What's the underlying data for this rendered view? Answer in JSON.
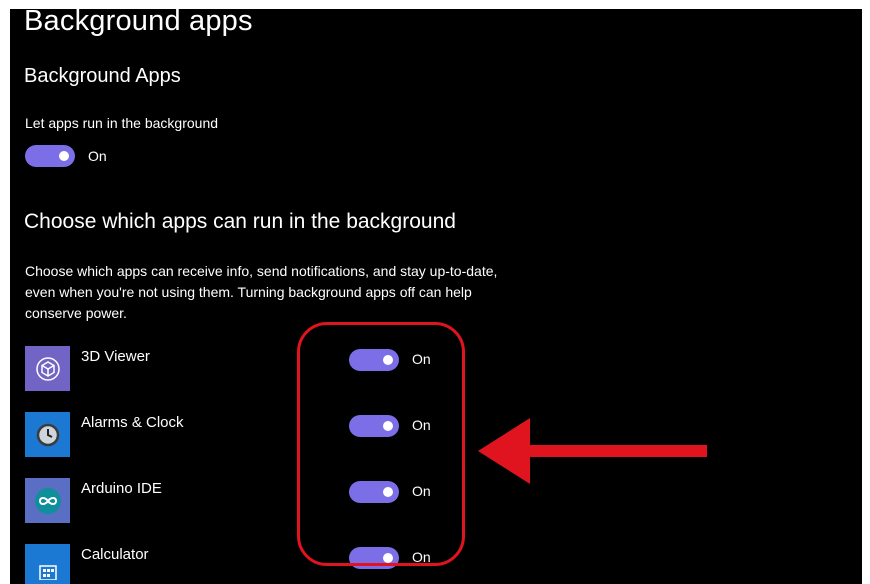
{
  "page": {
    "title": "Background apps"
  },
  "background_apps": {
    "section_title": "Background Apps",
    "setting_label": "Let apps run in the background",
    "toggle_state": "On",
    "toggle_on": true
  },
  "choose_apps": {
    "section_title": "Choose which apps can run in the background",
    "description": "Choose which apps can receive info, send notifications, and stay up-to-date, even when you're not using them. Turning background apps off can help conserve power.",
    "apps": [
      {
        "name": "3D Viewer",
        "icon": "cube-icon",
        "tile_color": "#7264c4",
        "toggle_state": "On",
        "toggle_on": true
      },
      {
        "name": "Alarms & Clock",
        "icon": "clock-icon",
        "tile_color": "#1b78d3",
        "toggle_state": "On",
        "toggle_on": true
      },
      {
        "name": "Arduino IDE",
        "icon": "infinity-icon",
        "tile_color": "#5a6fc4",
        "toggle_state": "On",
        "toggle_on": true
      },
      {
        "name": "Calculator",
        "icon": "calculator-icon",
        "tile_color": "#1b78d3",
        "toggle_state": "On",
        "toggle_on": true
      }
    ]
  },
  "colors": {
    "background": "#000000",
    "toggle_on": "#7b6ee6",
    "annotation_red": "#e0141e"
  }
}
